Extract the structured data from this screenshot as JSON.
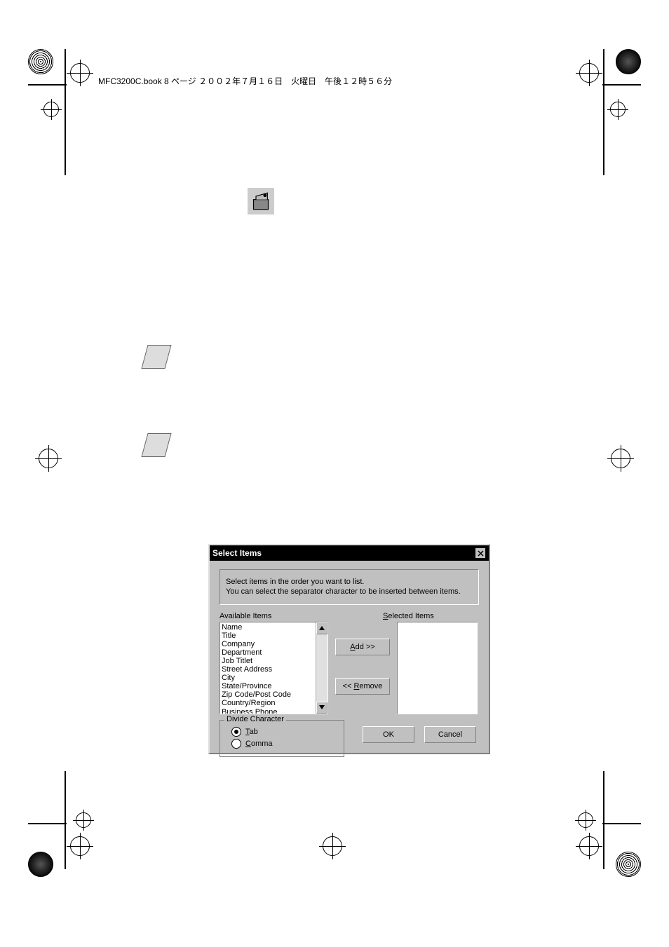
{
  "header": {
    "text": "MFC3200C.book 8 ページ ２００２年７月１６日　火曜日　午後１２時５６分"
  },
  "dialog": {
    "title": "Select Items",
    "info_line1": "Select items in the order you want to list.",
    "info_line2": "You can select the separator character to be inserted between items.",
    "available_label": "Available Items",
    "selected_label": "Selected Items",
    "add_button": "Add >>",
    "remove_button": "<< Remove",
    "ok_button": "OK",
    "cancel_button": "Cancel",
    "divide_legend": "Divide Character",
    "radio_tab": "Tab",
    "radio_comma": "Comma",
    "available_items": [
      "Name",
      "Title",
      "Company",
      "Department",
      "Job Titlet",
      "Street Address",
      "City",
      "State/Province",
      "Zip Code/Post Code",
      "Country/Region",
      "Business Phone"
    ]
  }
}
